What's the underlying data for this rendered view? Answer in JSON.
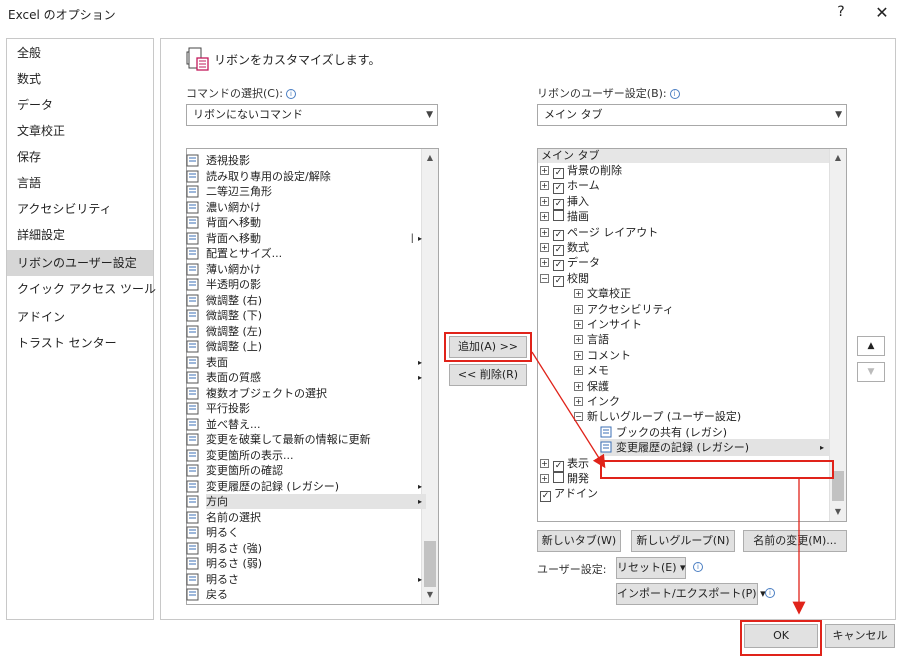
{
  "window": {
    "title": "Excel のオプション",
    "help_glyph": "?",
    "close_glyph": "✕"
  },
  "nav": {
    "items": [
      {
        "label": "全般"
      },
      {
        "label": "数式"
      },
      {
        "label": "データ"
      },
      {
        "label": "文章校正"
      },
      {
        "label": "保存"
      },
      {
        "label": "言語"
      },
      {
        "label": "アクセシビリティ"
      },
      {
        "label": "詳細設定"
      },
      {
        "label": "リボンのユーザー設定",
        "active": true
      },
      {
        "label": "クイック アクセス ツール バー"
      },
      {
        "label": "アドイン"
      },
      {
        "label": "トラスト センター"
      }
    ]
  },
  "header": {
    "title": "リボンをカスタマイズします。"
  },
  "left_panel": {
    "label": "コマンドの選択(C):",
    "combo_value": "リボンにないコマンド",
    "commands": [
      {
        "label": "透視投影"
      },
      {
        "label": "読み取り専用の設定/解除"
      },
      {
        "label": "二等辺三角形"
      },
      {
        "label": "濃い網かけ"
      },
      {
        "label": "背面へ移動"
      },
      {
        "label": "背面へ移動",
        "submenu_marker": "▏▸"
      },
      {
        "label": "配置とサイズ..."
      },
      {
        "label": "薄い網かけ"
      },
      {
        "label": "半透明の影"
      },
      {
        "label": "微調整 (右)"
      },
      {
        "label": "微調整 (下)"
      },
      {
        "label": "微調整 (左)"
      },
      {
        "label": "微調整 (上)"
      },
      {
        "label": "表面",
        "submenu_marker": "▸"
      },
      {
        "label": "表面の質感",
        "submenu_marker": "▸"
      },
      {
        "label": "複数オブジェクトの選択"
      },
      {
        "label": "平行投影"
      },
      {
        "label": "並べ替え..."
      },
      {
        "label": "変更を破棄して最新の情報に更新"
      },
      {
        "label": "変更箇所の表示..."
      },
      {
        "label": "変更箇所の確認"
      },
      {
        "label": "変更履歴の記録 (レガシー)",
        "submenu_marker": "▸"
      },
      {
        "label": "方向",
        "submenu_marker": "▸",
        "selected": true
      },
      {
        "label": "名前の選択"
      },
      {
        "label": "明るく"
      },
      {
        "label": "明るさ (強)"
      },
      {
        "label": "明るさ (弱)"
      },
      {
        "label": "明るさ",
        "submenu_marker": "▸"
      },
      {
        "label": "戻る"
      }
    ]
  },
  "middle": {
    "add_button": "追加(A) >>",
    "remove_button": "<< 削除(R)"
  },
  "right_panel": {
    "label": "リボンのユーザー設定(B):",
    "combo_value": "メイン タブ",
    "tree_header": "メイン タブ",
    "tree": [
      {
        "level": 0,
        "expander": "⊞",
        "checked": true,
        "label": "背景の削除"
      },
      {
        "level": 0,
        "expander": "⊞",
        "checked": true,
        "label": "ホーム"
      },
      {
        "level": 0,
        "expander": "⊞",
        "checked": true,
        "label": "挿入"
      },
      {
        "level": 0,
        "expander": "⊞",
        "checked": false,
        "label": "描画"
      },
      {
        "level": 0,
        "expander": "⊞",
        "checked": true,
        "label": "ページ レイアウト"
      },
      {
        "level": 0,
        "expander": "⊞",
        "checked": true,
        "label": "数式"
      },
      {
        "level": 0,
        "expander": "⊞",
        "checked": true,
        "label": "データ"
      },
      {
        "level": 0,
        "expander": "⊟",
        "checked": true,
        "label": "校閲"
      },
      {
        "level": 1,
        "expander": "⊞",
        "label": "文章校正"
      },
      {
        "level": 1,
        "expander": "⊞",
        "label": "アクセシビリティ"
      },
      {
        "level": 1,
        "expander": "⊞",
        "label": "インサイト"
      },
      {
        "level": 1,
        "expander": "⊞",
        "label": "言語"
      },
      {
        "level": 1,
        "expander": "⊞",
        "label": "コメント"
      },
      {
        "level": 1,
        "expander": "⊞",
        "label": "メモ"
      },
      {
        "level": 1,
        "expander": "⊞",
        "label": "保護"
      },
      {
        "level": 1,
        "expander": "⊞",
        "label": "インク"
      },
      {
        "level": 1,
        "expander": "⊟",
        "label": "新しいグループ (ユーザー設定)"
      },
      {
        "level": 2,
        "label": "ブックの共有 (レガシ)"
      },
      {
        "level": 2,
        "label": "変更履歴の記録 (レガシー)",
        "selected": true,
        "submenu_marker": "▸"
      },
      {
        "level": 0,
        "expander": "⊞",
        "checked": true,
        "label": "表示"
      },
      {
        "level": 0,
        "expander": "⊞",
        "checked": false,
        "label": "開発"
      },
      {
        "level": 0,
        "expander": "",
        "checked": true,
        "label": "アドイン"
      }
    ],
    "new_tab_button": "新しいタブ(W)",
    "new_group_button": "新しいグループ(N)",
    "rename_button": "名前の変更(M)...",
    "customize_label": "ユーザー設定:",
    "reset_button": "リセット(E) ▾",
    "import_export_button": "インポート/エクスポート(P) ▾",
    "move_up": "▲",
    "move_down": "▼"
  },
  "footer": {
    "ok_button": "OK",
    "cancel_button": "キャンセル"
  },
  "colors": {
    "annotation_red": "#e0231a",
    "selection_gray": "#e3e3e3",
    "nav_active": "#d6d6d6"
  }
}
